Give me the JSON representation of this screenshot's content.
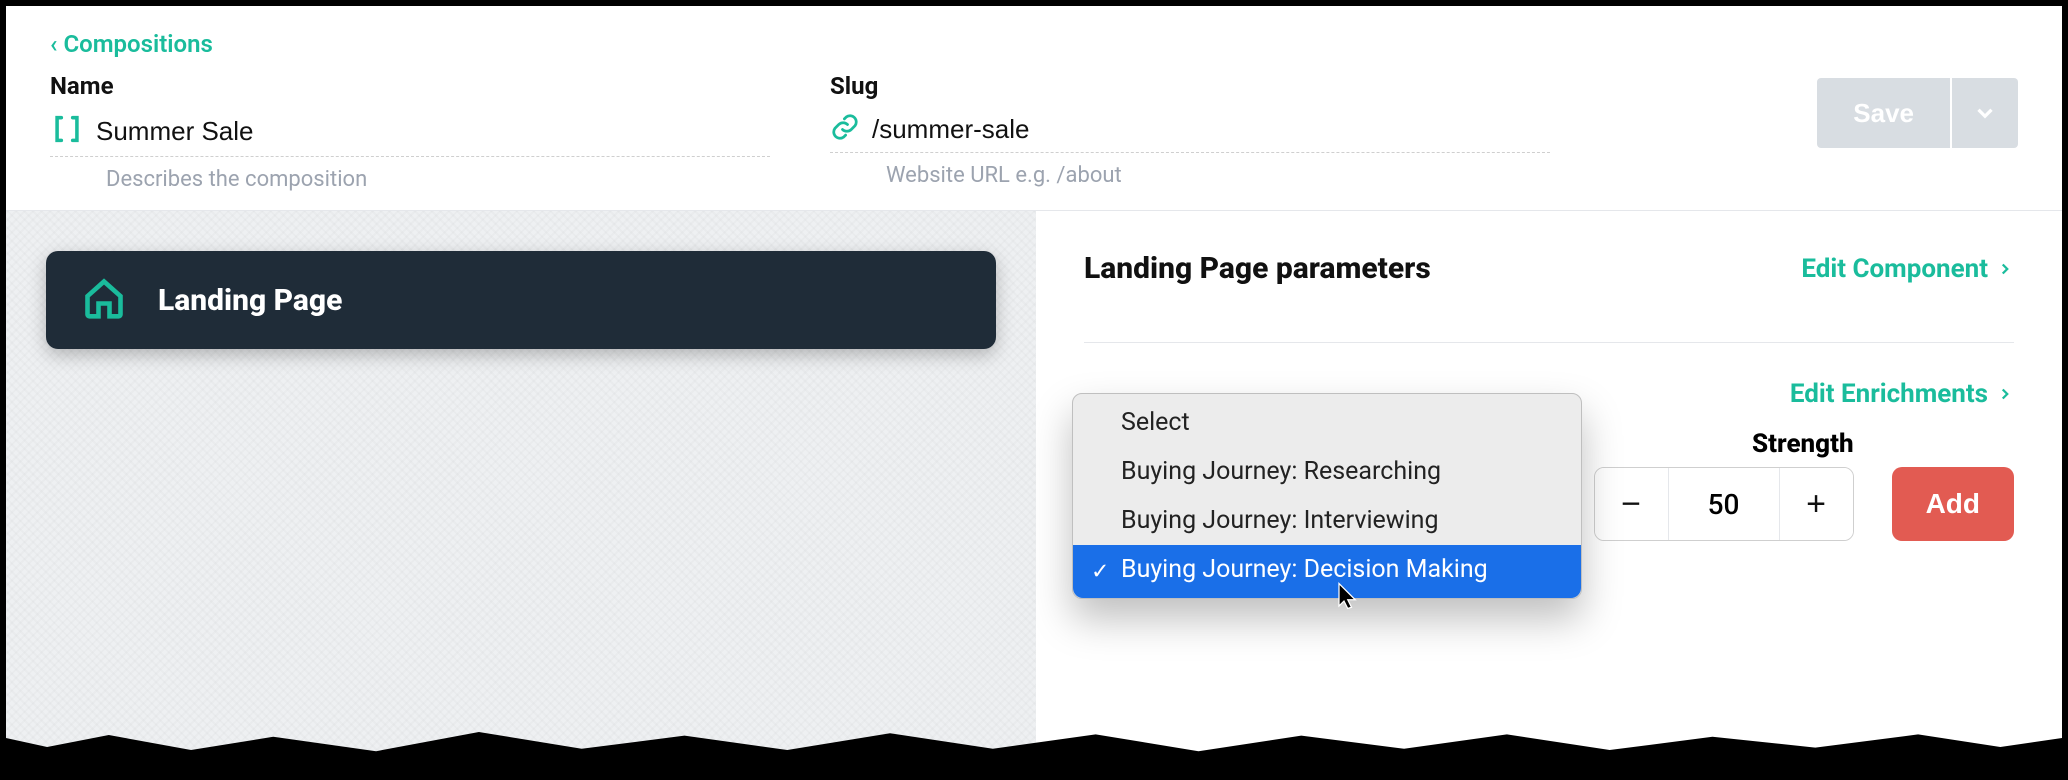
{
  "breadcrumb": {
    "label": "Compositions"
  },
  "fields": {
    "name": {
      "label": "Name",
      "value": "Summer Sale",
      "help": "Describes the composition"
    },
    "slug": {
      "label": "Slug",
      "value": "/summer-sale",
      "help": "Website URL e.g. /about"
    }
  },
  "save": {
    "label": "Save"
  },
  "left": {
    "card_title": "Landing Page"
  },
  "right": {
    "panel_title": "Landing Page parameters",
    "edit_component": "Edit Component",
    "edit_enrichments": "Edit Enrichments",
    "strength_label": "Strength",
    "strength_value": "50",
    "add_label": "Add"
  },
  "dropdown": {
    "options": [
      "Select",
      "Buying Journey: Researching",
      "Buying Journey: Interviewing",
      "Buying Journey: Decision Making"
    ],
    "selected_index": 3
  },
  "colors": {
    "teal": "#1abc9c",
    "dark": "#1f2c38",
    "danger": "#e25b52",
    "select_blue": "#1a6fe8"
  }
}
